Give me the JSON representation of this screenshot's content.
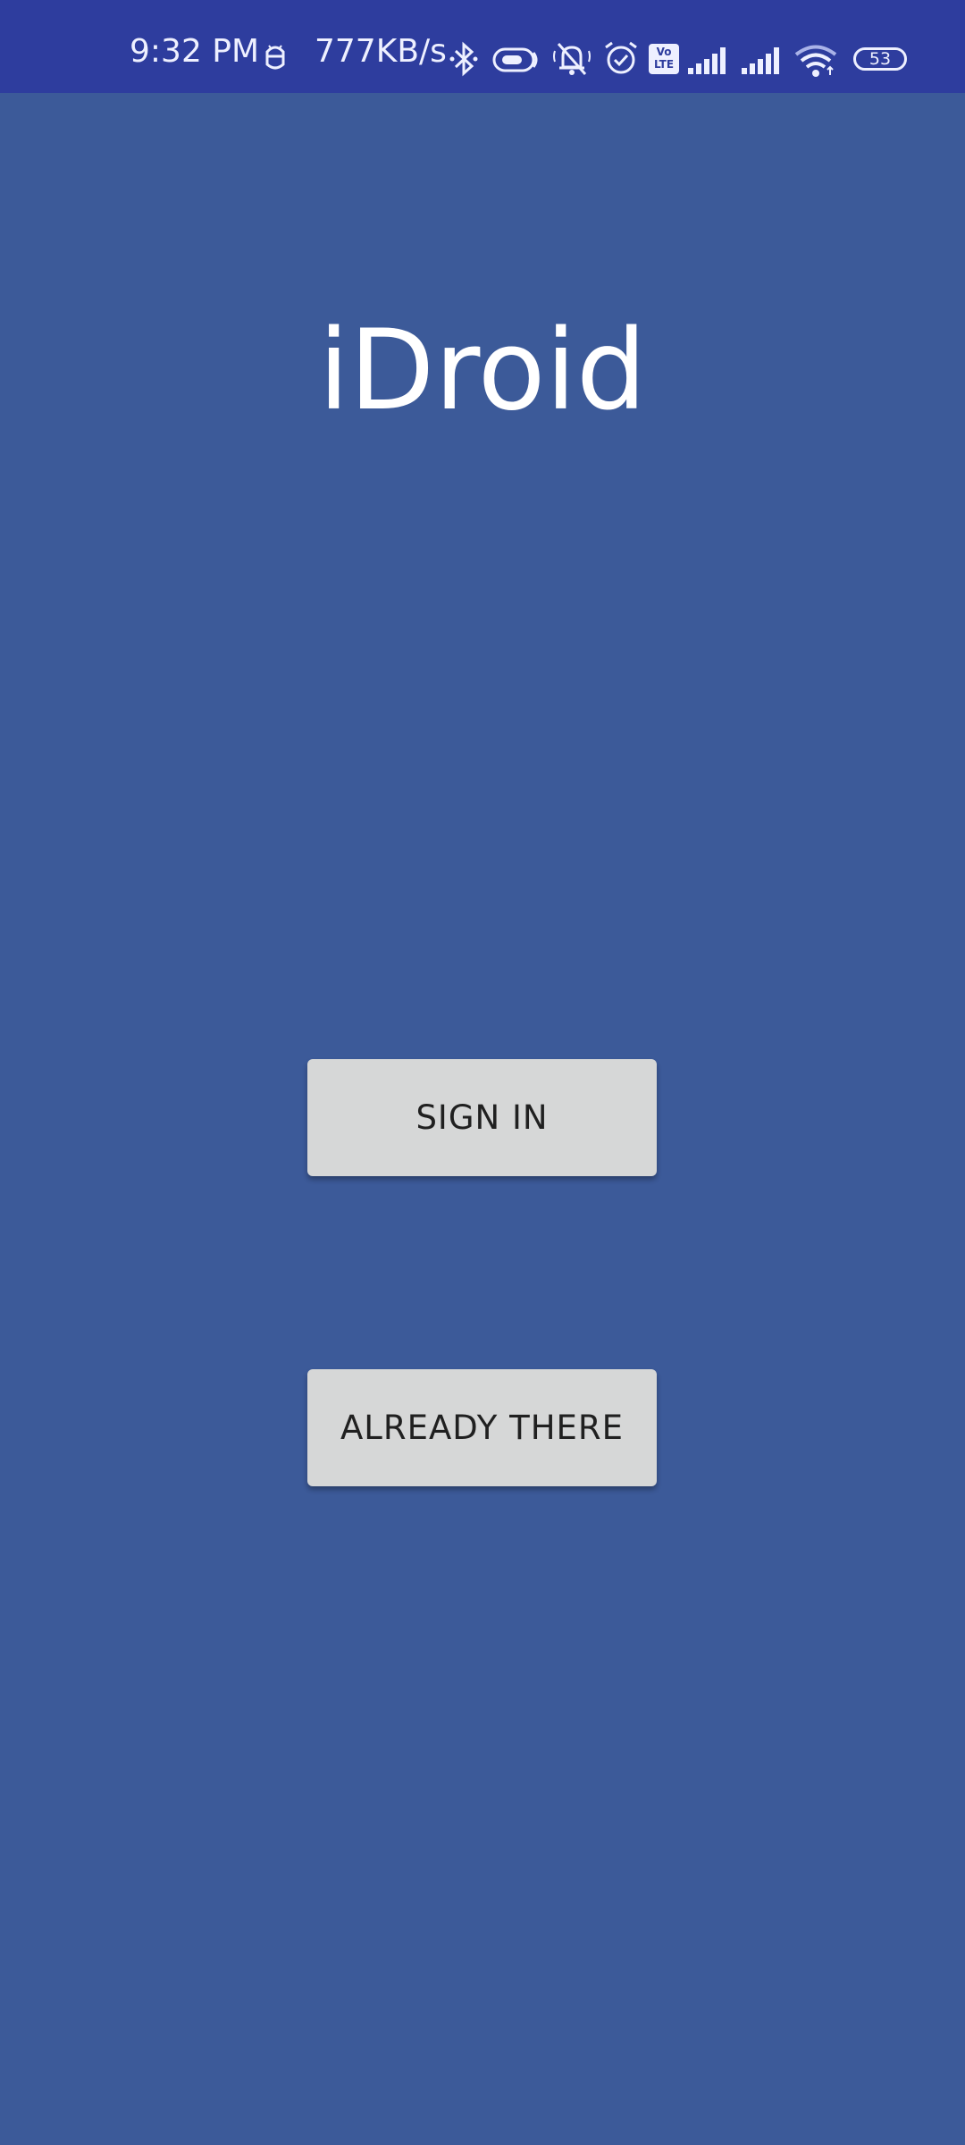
{
  "status_bar": {
    "time": "9:32 PM",
    "network_speed": "777KB/s",
    "battery_level": "53",
    "icons": [
      "android-debug-icon",
      "bluetooth-icon",
      "toggle-icon",
      "mute-icon",
      "alarm-icon",
      "volte-icon",
      "signal-1-icon",
      "signal-2-icon",
      "wifi-icon",
      "battery-icon"
    ],
    "volte_line1": "Vo",
    "volte_line2": "LTE"
  },
  "app": {
    "title": "iDroid",
    "background_color": "#3c5a99",
    "status_bar_color": "#2e3d9e"
  },
  "buttons": {
    "sign_in": "SIGN IN",
    "already_there": "ALREADY THERE"
  }
}
